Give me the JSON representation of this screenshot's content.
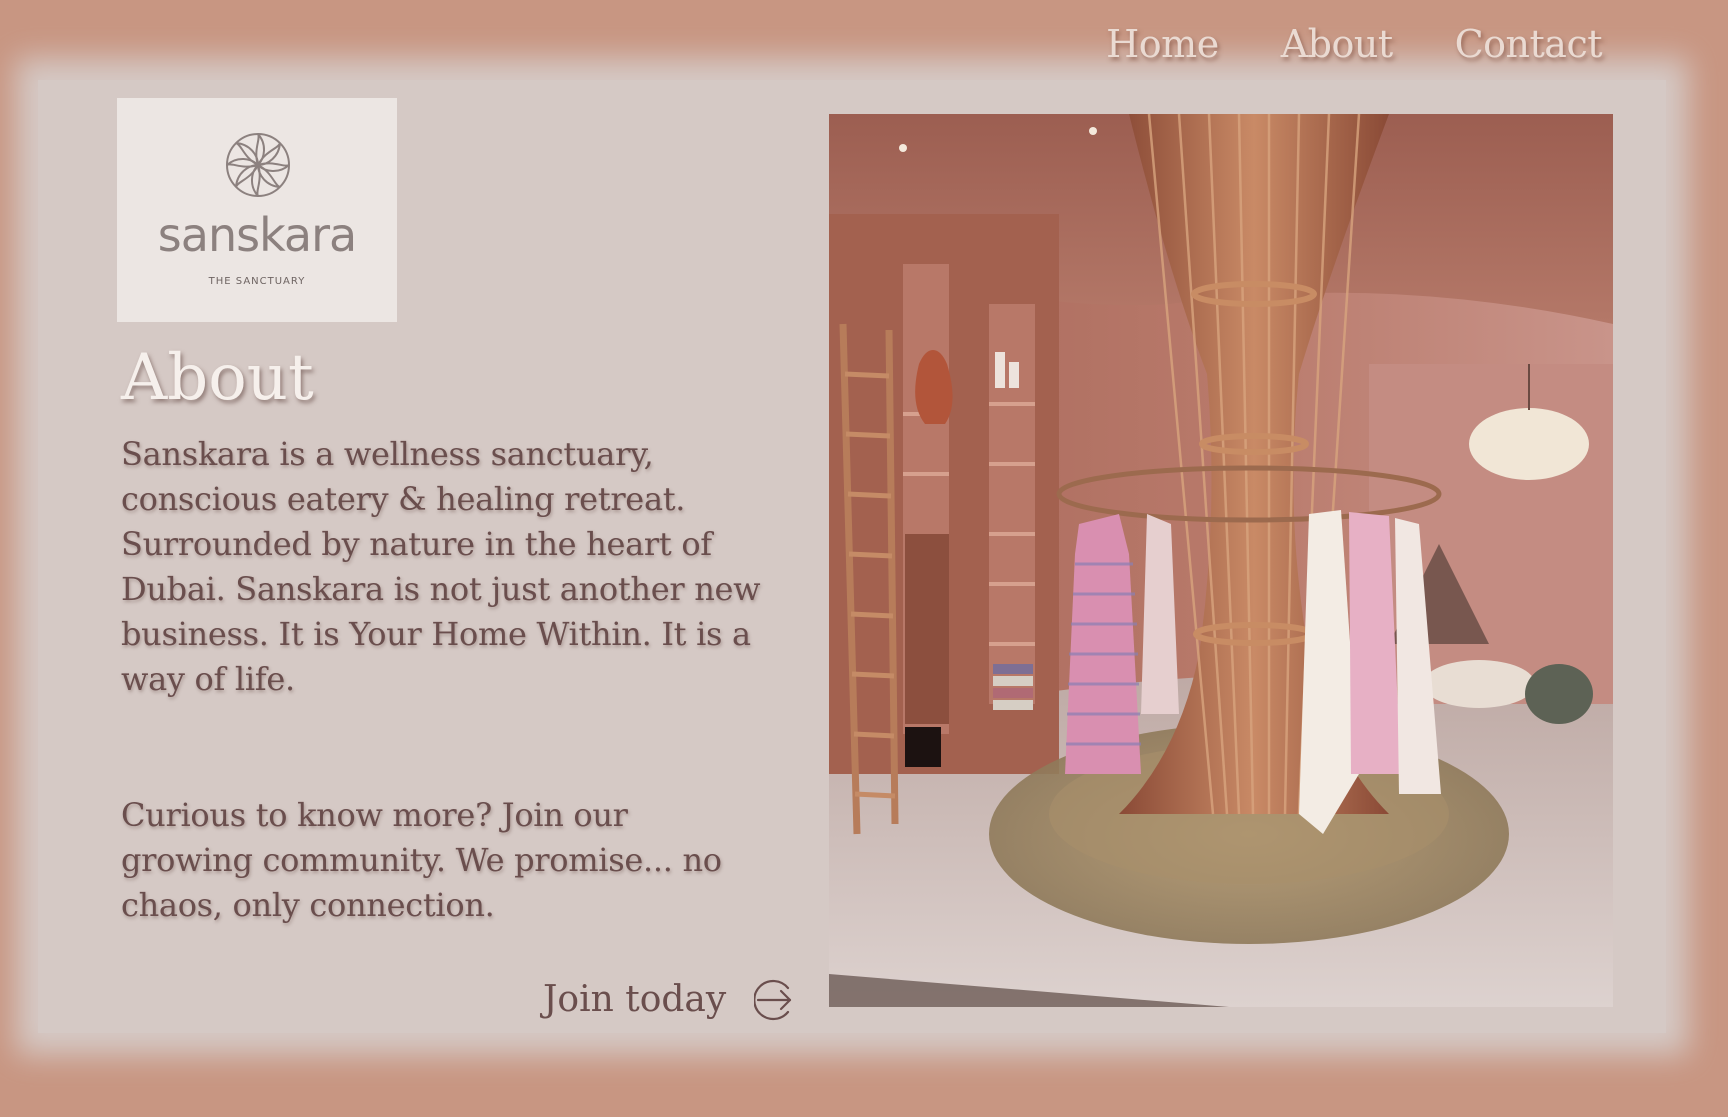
{
  "nav": {
    "items": [
      {
        "label": "Home"
      },
      {
        "label": "About"
      },
      {
        "label": "Contact"
      }
    ]
  },
  "logo": {
    "wordmark": "sanskara",
    "tagline": "THE SANCTUARY",
    "icon": "lotus-mandala-icon"
  },
  "about": {
    "heading": "About",
    "paragraph_1": "Sanskara is a wellness sanctuary, conscious eatery & healing retreat. Surrounded by nature in the heart of Dubai. Sanskara is not just another new business. It is Your Home Within. It is a way of life.",
    "paragraph_2": "Curious to know more? Join our growing community. We promise... no chaos, only connection."
  },
  "cta": {
    "label": "Join today",
    "icon": "arrow-right-circle-icon"
  },
  "colors": {
    "background": "#c89682",
    "panel": "#d5c9c5",
    "text": "#6a4e4d",
    "heading": "#f6f0ec"
  }
}
